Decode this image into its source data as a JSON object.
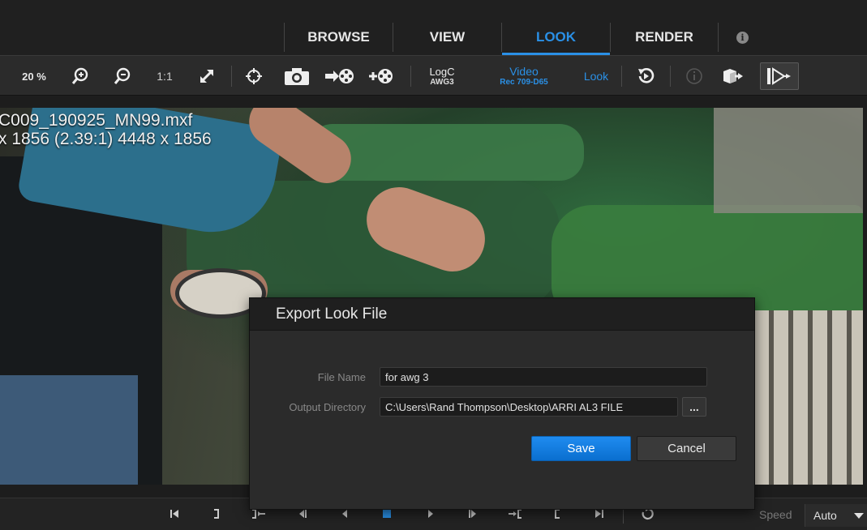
{
  "tabs": [
    {
      "label": "BROWSE"
    },
    {
      "label": "VIEW"
    },
    {
      "label": "LOOK"
    },
    {
      "label": "RENDER"
    }
  ],
  "info_glyph": "i",
  "toolbar": {
    "zoom_value": "20 %",
    "ratio_label": "1:1",
    "input_cs": {
      "main": "LogC",
      "sub": "AWG3"
    },
    "output_cs": {
      "main": "Video",
      "sub": "Rec 709-D65"
    },
    "look_label": "Look",
    "accent_color": "#2a90e6"
  },
  "viewer": {
    "file_name": "C009_190925_MN99.mxf",
    "resolution_line": "x 1856 (2.39:1)  4448 x 1856"
  },
  "dialog": {
    "title": "Export Look File",
    "file_name_label": "File Name",
    "file_name_value": "for awg 3",
    "output_dir_label": "Output Directory",
    "output_dir_value": "C:\\Users\\Rand Thompson\\Desktop\\ARRI AL3 FILE",
    "browse_label": "...",
    "save_label": "Save",
    "cancel_label": "Cancel"
  },
  "transport": {
    "speed_label": "Speed",
    "speed_value": "Auto"
  }
}
